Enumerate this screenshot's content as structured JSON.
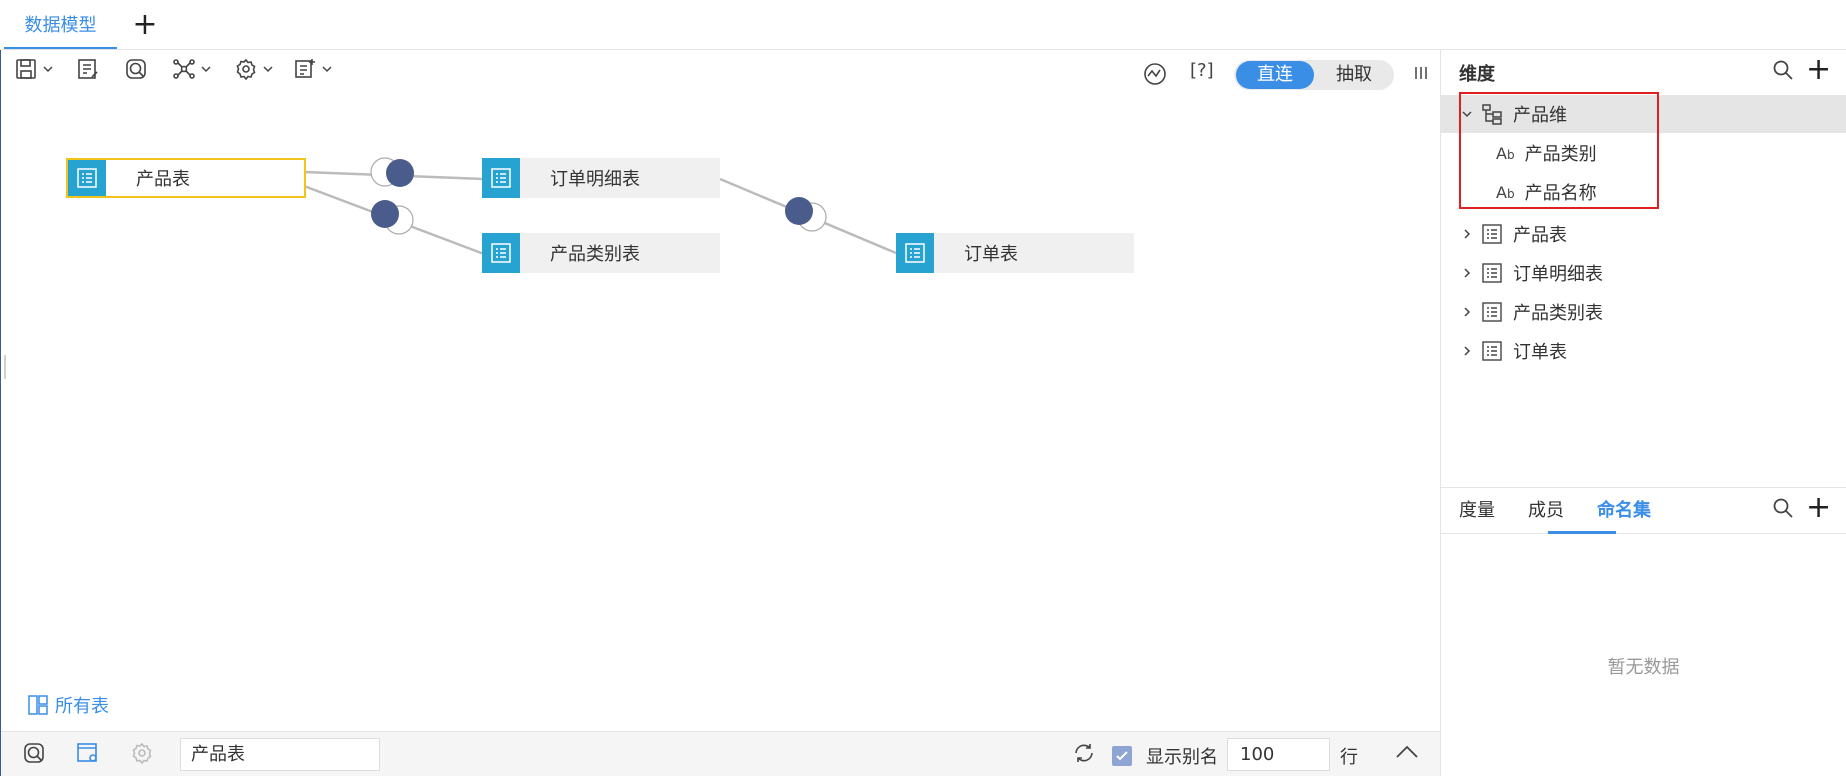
{
  "tabs": [
    {
      "label": "数据模型"
    }
  ],
  "mode": {
    "direct_label": "直连",
    "extract_label": "抽取",
    "active": "direct"
  },
  "help_label": "[?]",
  "canvas": {
    "nodes": [
      {
        "label": "产品表",
        "selected": true
      },
      {
        "label": "订单明细表",
        "selected": false
      },
      {
        "label": "产品类别表",
        "selected": false
      },
      {
        "label": "订单表",
        "selected": false
      }
    ],
    "all_tables_label": "所有表"
  },
  "bottom_bar": {
    "table_value": "产品表",
    "show_alias_label": "显示别名",
    "show_alias_checked": true,
    "row_count": "100",
    "row_unit": "行"
  },
  "right_panel": {
    "dimensions_title": "维度",
    "tree": [
      {
        "label": "产品维",
        "expanded": true,
        "children": [
          {
            "label": "产品类别"
          },
          {
            "label": "产品名称"
          }
        ]
      },
      {
        "label": "产品表",
        "expanded": false
      },
      {
        "label": "订单明细表",
        "expanded": false
      },
      {
        "label": "产品类别表",
        "expanded": false
      },
      {
        "label": "订单表",
        "expanded": false
      }
    ],
    "bottom_tabs": [
      {
        "label": "度量"
      },
      {
        "label": "成员"
      },
      {
        "label": "命名集"
      }
    ],
    "active_bottom_tab": "命名集",
    "empty_text": "暂无数据"
  },
  "colors": {
    "accent": "#3a8ee6",
    "node_icon": "#27a3d1",
    "join_dot": "#4a5c8c",
    "selection": "#f0c419",
    "highlight_box": "#e02020"
  }
}
